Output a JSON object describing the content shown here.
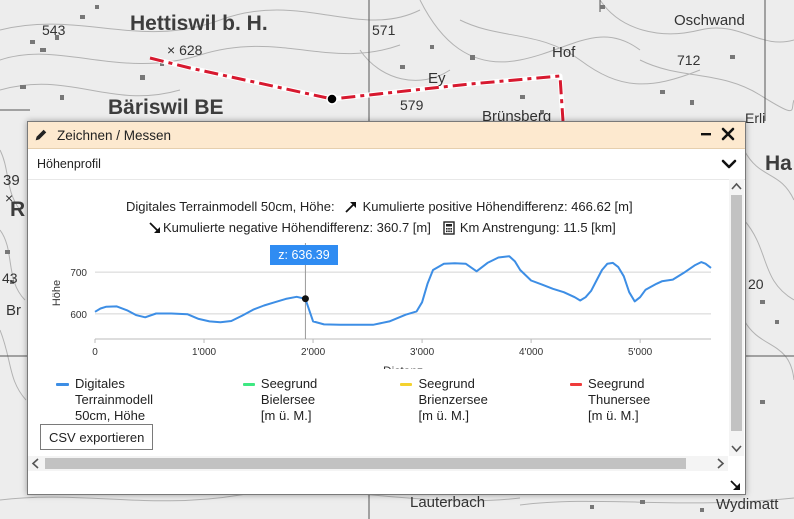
{
  "map": {
    "labels": {
      "hettiswil": "Hettiswil b. H.",
      "h628": "× 628",
      "h543": "543",
      "h571": "571",
      "oschwand": "Oschwand",
      "h712": "712",
      "hof": "Hof",
      "ey": "Ey",
      "h579": "579",
      "bariswil": "Bäriswil BE",
      "brunsberg": "Brünsberg",
      "erli": "Erli",
      "ha": "Ha",
      "h39": "39",
      "h20": "20",
      "lauterbach": "Lauterbach",
      "wydimatt": "Wydimatt",
      "bra": "Br",
      "r": "R",
      "x": "×",
      "h43": "43"
    },
    "route_color": "#d7192f"
  },
  "window": {
    "title": "Zeichnen / Messen",
    "minimize_icon": "minimize-icon",
    "close_icon": "close-icon"
  },
  "profile": {
    "section_title": "Höhenprofil",
    "stat_model": "Digitales Terrainmodell 50cm, Höhe:",
    "stat_pos": "Kumulierte positive Höhendifferenz: 466.62 [m]",
    "stat_neg": "Kumulierte negative Höhendifferenz: 360.7 [m]",
    "stat_km": "Km Anstrengung: 11.5 [km]",
    "tooltip": "z: 636.39",
    "csv_button": "CSV exportieren",
    "legend": [
      {
        "line1": "Digitales Terrainmodell",
        "line2": "50cm, Höhe",
        "color": "#3d8ee5"
      },
      {
        "line1": "Seegrund",
        "line2": "Bielersee [m ü. M.]",
        "color": "#3ee882"
      },
      {
        "line1": "Seegrund",
        "line2": "Brienzersee [m ü. M.]",
        "color": "#f4d22e"
      },
      {
        "line1": "Seegrund",
        "line2": "Thunersee [m ü. M.]",
        "color": "#ef3b3b"
      }
    ]
  },
  "chart_data": {
    "type": "line",
    "xlabel": "Distanz",
    "ylabel": "Höhe",
    "x_ticks": [
      0,
      1000,
      2000,
      3000,
      4000,
      5000
    ],
    "x_tick_labels": [
      "0",
      "1'000",
      "2'000",
      "3'000",
      "4'000",
      "5'000"
    ],
    "y_ticks": [
      600,
      700
    ],
    "y_tick_labels": [
      "600",
      "700"
    ],
    "xlim": [
      0,
      5650
    ],
    "ylim": [
      540,
      760
    ],
    "grid": true,
    "series": [
      {
        "name": "Digitales Terrainmodell 50cm, Höhe",
        "color": "#3d8ee5",
        "x": [
          0,
          50,
          100,
          200,
          300,
          380,
          460,
          560,
          700,
          850,
          950,
          1050,
          1150,
          1250,
          1350,
          1450,
          1550,
          1650,
          1750,
          1850,
          1930,
          2000,
          2100,
          2250,
          2400,
          2550,
          2700,
          2850,
          2950,
          3000,
          3050,
          3100,
          3200,
          3300,
          3400,
          3500,
          3600,
          3700,
          3800,
          3850,
          3900,
          4000,
          4100,
          4200,
          4300,
          4400,
          4450,
          4500,
          4550,
          4600,
          4650,
          4700,
          4750,
          4800,
          4850,
          4900,
          4950,
          5000,
          5050,
          5100,
          5150,
          5200,
          5300,
          5400,
          5500,
          5560,
          5600,
          5650
        ],
        "y": [
          605,
          613,
          617,
          618,
          608,
          597,
          592,
          601,
          601,
          599,
          588,
          582,
          580,
          583,
          596,
          610,
          620,
          628,
          636,
          641,
          636,
          582,
          575,
          574,
          574,
          574,
          582,
          598,
          606,
          628,
          672,
          705,
          720,
          721,
          720,
          702,
          722,
          735,
          738,
          726,
          705,
          680,
          670,
          660,
          652,
          640,
          632,
          640,
          655,
          680,
          705,
          720,
          722,
          712,
          690,
          652,
          630,
          640,
          658,
          665,
          672,
          678,
          682,
          698,
          716,
          724,
          720,
          710
        ]
      }
    ],
    "highlight": {
      "x": 1930,
      "y": 636.39
    }
  }
}
